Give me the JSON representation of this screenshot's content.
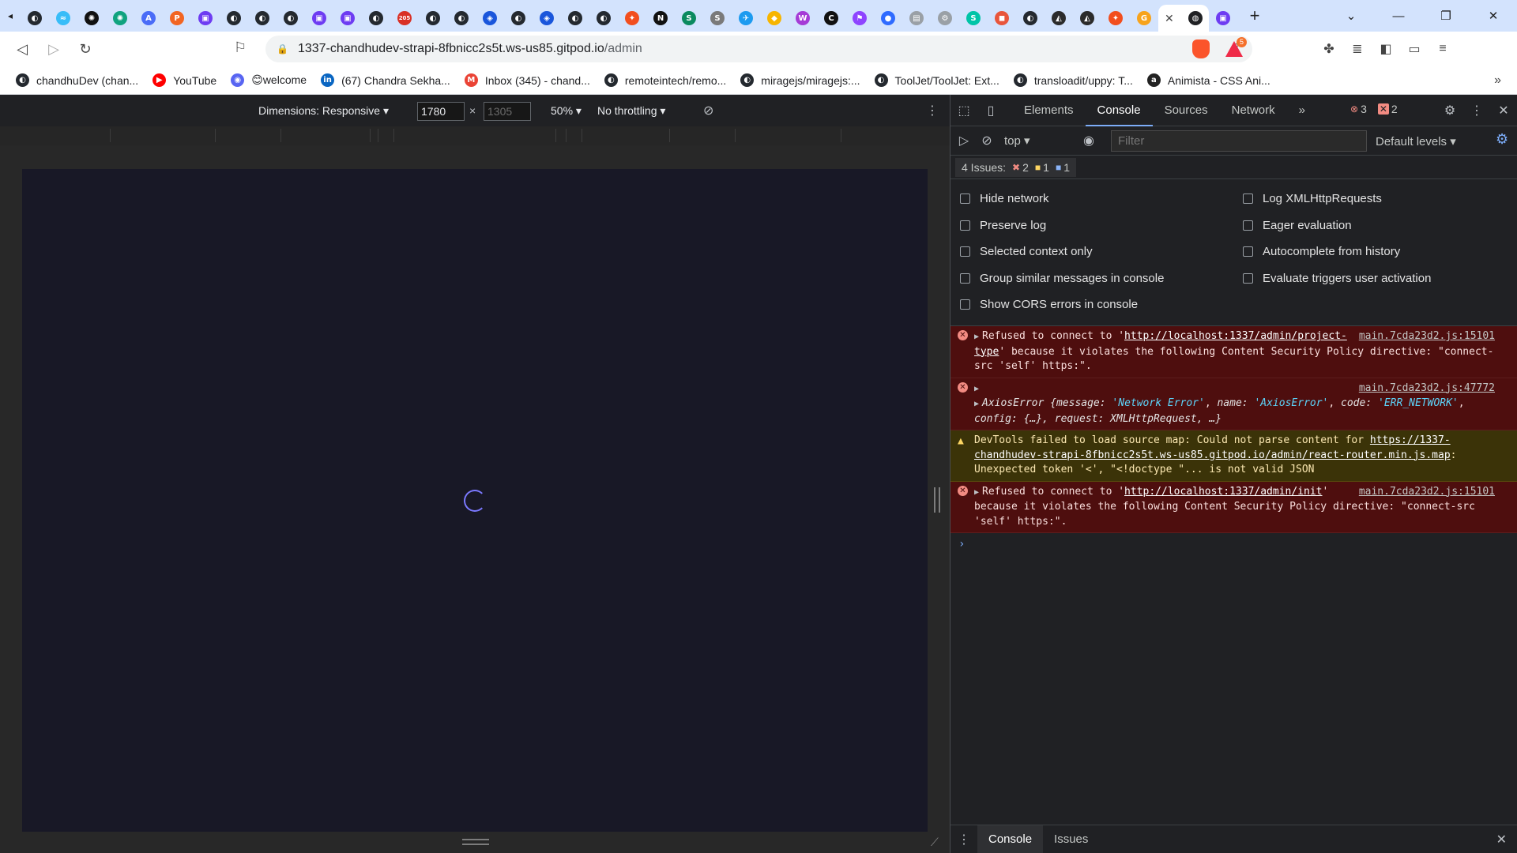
{
  "tabs": {
    "favicons": [
      {
        "name": "github-icon",
        "glyph": "◐",
        "color": "#24292f"
      },
      {
        "name": "tailwind-icon",
        "glyph": "≈",
        "color": "#38bdf8"
      },
      {
        "name": "openai-icon",
        "glyph": "✺",
        "color": "#111"
      },
      {
        "name": "openai-icon",
        "glyph": "✺",
        "color": "#10a37f"
      },
      {
        "name": "a-icon",
        "glyph": "A",
        "color": "#4a6cf7"
      },
      {
        "name": "p-icon",
        "glyph": "P",
        "color": "#f26522"
      },
      {
        "name": "purple-icon",
        "glyph": "▣",
        "color": "#6e3cf2"
      },
      {
        "name": "github-icon",
        "glyph": "◐",
        "color": "#24292f"
      },
      {
        "name": "github-icon",
        "glyph": "◐",
        "color": "#24292f"
      },
      {
        "name": "github-icon",
        "glyph": "◐",
        "color": "#24292f"
      },
      {
        "name": "purple-icon",
        "glyph": "▣",
        "color": "#6e3cf2"
      },
      {
        "name": "purple-icon",
        "glyph": "▣",
        "color": "#6e3cf2"
      },
      {
        "name": "github-icon",
        "glyph": "◐",
        "color": "#24292f"
      },
      {
        "name": "notifications-icon",
        "glyph": "205",
        "color": "#d93025"
      },
      {
        "name": "github-icon",
        "glyph": "◐",
        "color": "#24292f"
      },
      {
        "name": "github-icon",
        "glyph": "◐",
        "color": "#24292f"
      },
      {
        "name": "shield-icon",
        "glyph": "◈",
        "color": "#1a56db"
      },
      {
        "name": "github-icon",
        "glyph": "◐",
        "color": "#24292f"
      },
      {
        "name": "shield-icon",
        "glyph": "◈",
        "color": "#1a56db"
      },
      {
        "name": "github-icon",
        "glyph": "◐",
        "color": "#24292f"
      },
      {
        "name": "github-icon",
        "glyph": "◐",
        "color": "#24292f"
      },
      {
        "name": "figma-icon",
        "glyph": "✦",
        "color": "#f24e1e"
      },
      {
        "name": "notion-icon",
        "glyph": "N",
        "color": "#111"
      },
      {
        "name": "s-icon",
        "glyph": "S",
        "color": "#0b8a5f"
      },
      {
        "name": "s-icon",
        "glyph": "S",
        "color": "#7a7a7a"
      },
      {
        "name": "twitter-icon",
        "glyph": "✈",
        "color": "#1d9bf0"
      },
      {
        "name": "sketch-icon",
        "glyph": "◆",
        "color": "#f7b500"
      },
      {
        "name": "w-icon",
        "glyph": "W",
        "color": "#a53bd6"
      },
      {
        "name": "c-icon",
        "glyph": "C",
        "color": "#111"
      },
      {
        "name": "flag-icon",
        "glyph": "⚑",
        "color": "#8e44ff"
      },
      {
        "name": "circle-icon",
        "glyph": "●",
        "color": "#2f6bff"
      },
      {
        "name": "page-icon",
        "glyph": "▤",
        "color": "#9aa0a6"
      },
      {
        "name": "gear-icon",
        "glyph": "⚙",
        "color": "#9aa0a6"
      },
      {
        "name": "s-icon",
        "glyph": "S",
        "color": "#00c4a7"
      },
      {
        "name": "box-icon",
        "glyph": "◼",
        "color": "#e8553b"
      },
      {
        "name": "github-icon",
        "glyph": "◐",
        "color": "#24292f"
      },
      {
        "name": "stack-icon",
        "glyph": "◭",
        "color": "#2b2b2b"
      },
      {
        "name": "stack-icon",
        "glyph": "◭",
        "color": "#2b2b2b"
      },
      {
        "name": "figma-icon",
        "glyph": "✦",
        "color": "#f24e1e"
      },
      {
        "name": "g-icon",
        "glyph": "G",
        "color": "#f7a31c"
      }
    ],
    "active_favicon": {
      "name": "globe-icon",
      "glyph": "◍",
      "color": "#202124"
    },
    "after_active": {
      "name": "purple-icon",
      "glyph": "▣",
      "color": "#6e3cf2"
    }
  },
  "address": {
    "host": "1337-chandhudev-strapi-8fbnicc2s5t.ws-us85.gitpod.io",
    "path": "/admin"
  },
  "extensions": {
    "rewards_badge": "5"
  },
  "bookmarks": [
    {
      "icon": "github-icon",
      "glyph": "◐",
      "color": "#24292f",
      "label": "chandhuDev (chan..."
    },
    {
      "icon": "youtube-icon",
      "glyph": "▶",
      "color": "#ff0000",
      "label": "YouTube"
    },
    {
      "icon": "discord-icon",
      "glyph": "◉",
      "color": "#5865f2",
      "label": "😊welcome"
    },
    {
      "icon": "linkedin-icon",
      "glyph": "in",
      "color": "#0a66c2",
      "label": "(67) Chandra Sekha..."
    },
    {
      "icon": "gmail-icon",
      "glyph": "M",
      "color": "#ea4335",
      "label": "Inbox (345) - chand..."
    },
    {
      "icon": "github-icon",
      "glyph": "◐",
      "color": "#24292f",
      "label": "remoteintech/remo..."
    },
    {
      "icon": "github-icon",
      "glyph": "◐",
      "color": "#24292f",
      "label": "miragejs/miragejs:..."
    },
    {
      "icon": "github-icon",
      "glyph": "◐",
      "color": "#24292f",
      "label": "ToolJet/ToolJet: Ext..."
    },
    {
      "icon": "github-icon",
      "glyph": "◐",
      "color": "#24292f",
      "label": "transloadit/uppy: T..."
    },
    {
      "icon": "animista-icon",
      "glyph": "a",
      "color": "#222",
      "label": "Animista - CSS Ani..."
    }
  ],
  "device_toolbar": {
    "dimensions_label": "Dimensions: Responsive",
    "width_value": "1780",
    "height_value": "1305",
    "times": "×",
    "zoom": "50%",
    "throttling": "No throttling"
  },
  "devtools": {
    "tabs": [
      "Elements",
      "Console",
      "Sources",
      "Network"
    ],
    "active_tab": "Console",
    "more": "»",
    "error_count": "3",
    "warning_count": "2",
    "context": "top",
    "filter_placeholder": "Filter",
    "levels": "Default levels",
    "issues": {
      "label": "4 Issues:",
      "errors": "2",
      "warnings": "1",
      "info": "1"
    },
    "settings": {
      "left": [
        "Hide network",
        "Preserve log",
        "Selected context only",
        "Group similar messages in console",
        "Show CORS errors in console"
      ],
      "right": [
        "Log XMLHttpRequests",
        "Eager evaluation",
        "Autocomplete from history",
        "Evaluate triggers user activation"
      ]
    },
    "messages": {
      "m1": {
        "pre": "Refused to connect to '",
        "url": "http://localhost:1337/admin/project-type",
        "post": "' because it violates the following Content Security Policy directive: \"connect-src 'self' https:\".",
        "source": "main.7cda23d2.js:15101"
      },
      "m2": {
        "source": "main.7cda23d2.js:47772",
        "class": "AxiosError",
        "k1": "message:",
        "v1": "'Network Error'",
        "k2": "name:",
        "v2": "'AxiosError'",
        "k3": "code:",
        "v3": "'ERR_NETWORK'",
        "rest": "config: {…}, request: XMLHttpRequest, …}"
      },
      "m3": {
        "pre": "DevTools failed to load source map: Could not parse content for ",
        "url": "https://1337-chandhudev-strapi-8fbnicc2s5t.ws-us85.gitpod.io/admin/react-router.min.js.map",
        "post": ": Unexpected token '<', \"<!doctype \"... is not valid JSON"
      },
      "m4": {
        "pre": "Refused to connect to '",
        "url": "http://localhost:1337/admin/init",
        "post": "' because it violates the following Content Security Policy directive: \"connect-src 'self' https:\".",
        "source": "main.7cda23d2.js:15101"
      }
    },
    "drawer_tabs": [
      "Console",
      "Issues"
    ]
  }
}
